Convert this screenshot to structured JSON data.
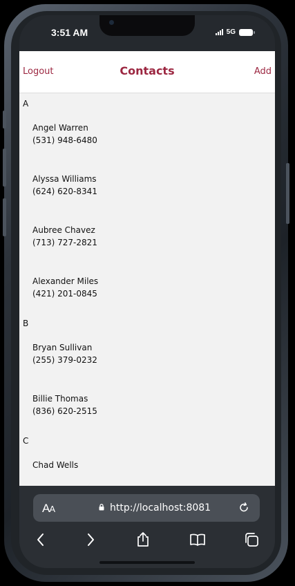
{
  "status_bar": {
    "time": "3:51 AM",
    "network": "5G",
    "icons": [
      "signal-icon",
      "battery-icon"
    ]
  },
  "navbar": {
    "left_label": "Logout",
    "title": "Contacts",
    "right_label": "Add"
  },
  "sections": [
    {
      "letter": "A",
      "contacts": [
        {
          "name": "Angel Warren",
          "phone": "(531) 948-6480"
        },
        {
          "name": "Alyssa Williams",
          "phone": "(624) 620-8341"
        },
        {
          "name": "Aubree Chavez",
          "phone": "(713) 727-2821"
        },
        {
          "name": "Alexander Miles",
          "phone": "(421) 201-0845"
        }
      ]
    },
    {
      "letter": "B",
      "contacts": [
        {
          "name": "Bryan Sullivan",
          "phone": "(255) 379-0232"
        },
        {
          "name": "Billie Thomas",
          "phone": "(836) 620-2515"
        }
      ]
    },
    {
      "letter": "C",
      "contacts": [
        {
          "name": "Chad Wells",
          "phone": ""
        }
      ]
    }
  ],
  "browser": {
    "text_size_label_large": "A",
    "text_size_label_small": "A",
    "url": "http://localhost:8081",
    "toolbar_icons": [
      "back-icon",
      "forward-icon",
      "share-icon",
      "bookmarks-icon",
      "tabs-icon"
    ]
  },
  "colors": {
    "accent": "#9c2741",
    "list_background": "#f2f2f2",
    "browser_chrome": "#2b2f34"
  }
}
